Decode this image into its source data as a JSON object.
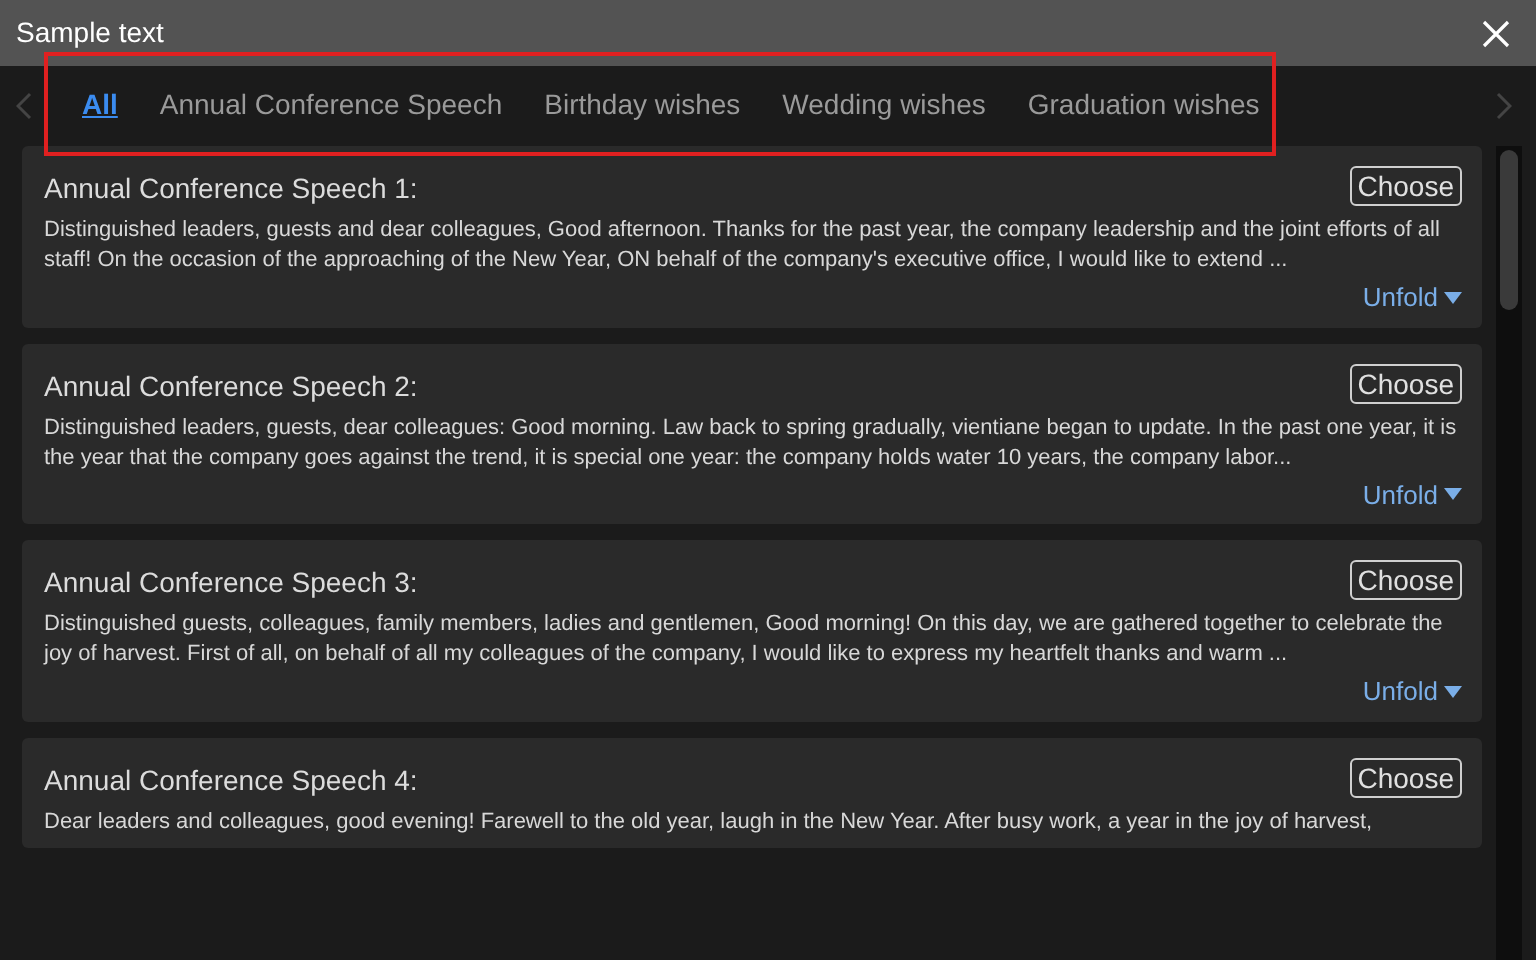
{
  "window": {
    "title": "Sample text"
  },
  "tabs": [
    {
      "label": "All",
      "selected": true
    },
    {
      "label": "Annual Conference Speech",
      "selected": false
    },
    {
      "label": "Birthday wishes",
      "selected": false
    },
    {
      "label": "Wedding wishes",
      "selected": false
    },
    {
      "label": "Graduation wishes",
      "selected": false
    }
  ],
  "cards": [
    {
      "title": "Annual Conference Speech 1:",
      "text": "Distinguished leaders, guests and dear colleagues, Good afternoon. Thanks for the past year, the company leadership and the joint efforts of all staff! On the occasion of the approaching of the New Year, ON behalf of the company's executive office, I would like to extend ...",
      "choose": "Choose",
      "unfold": "Unfold"
    },
    {
      "title": "Annual Conference Speech 2:",
      "text": "Distinguished leaders, guests, dear colleagues: Good morning. Law back to spring gradually, vientiane began to update. In the past one year, it is the year that the company goes against the trend, it is special one year: the company holds water 10 years, the company labor...",
      "choose": "Choose",
      "unfold": "Unfold"
    },
    {
      "title": "Annual Conference Speech 3:",
      "text": "Distinguished guests, colleagues, family members, ladies and gentlemen, Good morning! On this day, we are gathered together to celebrate the joy of harvest. First of all, on behalf of all my colleagues of the company, I would like to express my heartfelt thanks and warm ...",
      "choose": "Choose",
      "unfold": "Unfold"
    },
    {
      "title": "Annual Conference Speech 4:",
      "text": "Dear leaders and colleagues, good evening! Farewell to the old year, laugh in the New Year. After busy work, a year in the joy of harvest,",
      "choose": "Choose"
    }
  ]
}
